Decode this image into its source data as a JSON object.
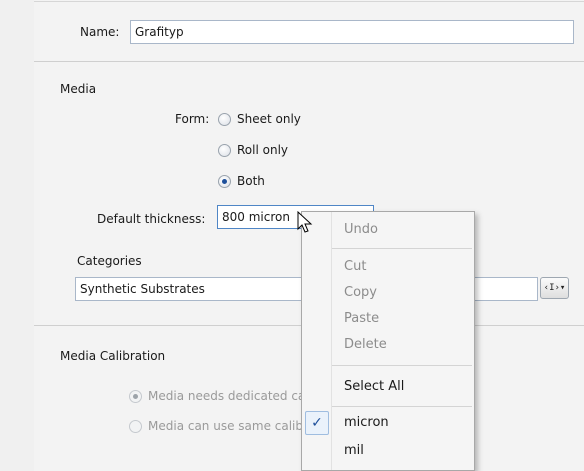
{
  "form": {
    "name_label": "Name:",
    "name_value": "Grafityp"
  },
  "media": {
    "heading": "Media",
    "form_label": "Form:",
    "options": [
      "Sheet only",
      "Roll only",
      "Both"
    ],
    "selected": "Both",
    "thickness_label": "Default thickness:",
    "thickness_value": "800 micron",
    "categories_label": "Categories",
    "categories_value": "Synthetic Substrates",
    "var_button_label": "‹I›"
  },
  "calibration": {
    "heading": "Media Calibration",
    "option1": "Media needs dedicated ca",
    "option2": "Media can use same calib"
  },
  "context_menu": {
    "undo": "Undo",
    "cut": "Cut",
    "copy": "Copy",
    "paste": "Paste",
    "delete": "Delete",
    "select_all": "Select All",
    "micron": "micron",
    "mil": "mil",
    "checked_unit": "micron"
  },
  "colors": {
    "accent": "#1d4f9a",
    "focus_border": "#4f86c6",
    "disabled_text": "#9a9a9a"
  }
}
